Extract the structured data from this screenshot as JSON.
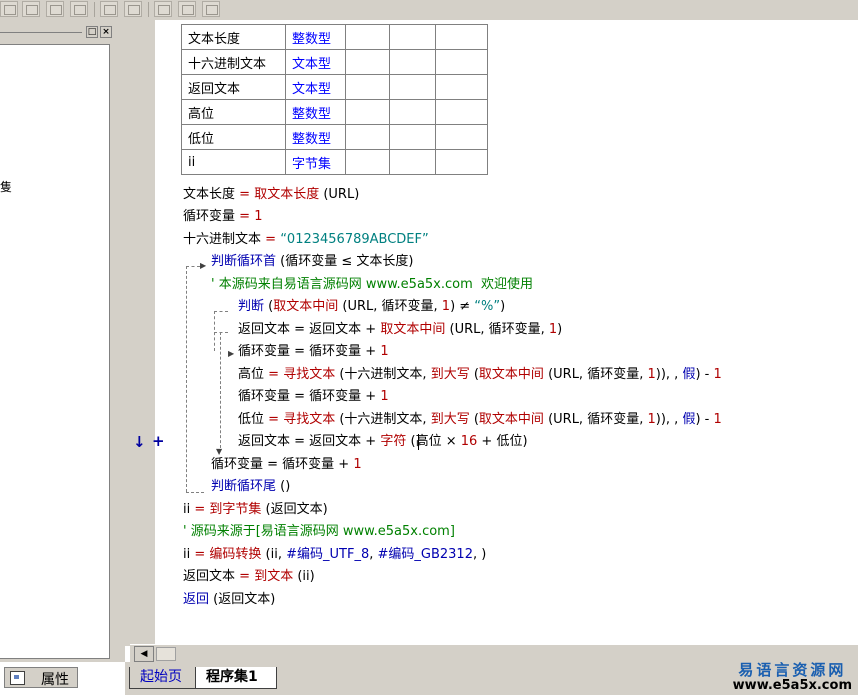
{
  "properties_tab": {
    "label": "属性"
  },
  "left_panel": {
    "minimize_label": "□",
    "close_label": "×",
    "visible_char": "隻"
  },
  "var_table": {
    "rows": [
      {
        "name": "文本长度",
        "type": "整数型"
      },
      {
        "name": "十六进制文本",
        "type": "文本型"
      },
      {
        "name": "返回文本",
        "type": "文本型"
      },
      {
        "name": "高位",
        "type": "整数型"
      },
      {
        "name": "低位",
        "type": "整数型"
      },
      {
        "name": "ii",
        "type": "字节集"
      }
    ]
  },
  "code": {
    "l1": {
      "a": "文本长度",
      "b": " = ",
      "c": "取文本长度",
      "d": " (URL)"
    },
    "l2": {
      "a": "循环变量",
      "b": " = ",
      "c": "1"
    },
    "l3": {
      "a": "十六进制文本",
      "b": " = ",
      "c": "“0123456789ABCDEF”"
    },
    "l4": {
      "a": "判断循环首",
      "b": " (循环变量 ≤ 文本长度)"
    },
    "l5": {
      "a": "' 本源码来自易语言源码网 www.e5a5x.com  欢迎使用"
    },
    "l6": {
      "a": "判断",
      "b": " (",
      "c": "取文本中间",
      "d": " (URL, 循环变量, ",
      "e": "1",
      "f": ") ≠ ",
      "g": "“%”",
      "h": ")"
    },
    "l7": {
      "a": "返回文本",
      "b": " = 返回文本 + ",
      "c": "取文本中间",
      "d": " (URL, 循环变量, ",
      "e": "1",
      "f": ")"
    },
    "l8": {
      "a": "循环变量",
      "b": " = 循环变量 + ",
      "c": "1"
    },
    "l9": {
      "a": "高位",
      "b": " = ",
      "c": "寻找文本",
      "d": " (十六进制文本, ",
      "e": "到大写",
      "f": " (",
      "g": "取文本中间",
      "h": " (URL, 循环变量, ",
      "i": "1",
      "j": ")), , ",
      "k": "假",
      "l": ") - ",
      "m": "1"
    },
    "l10": {
      "a": "循环变量",
      "b": " = 循环变量 + ",
      "c": "1"
    },
    "l11": {
      "a": "低位",
      "b": " = ",
      "c": "寻找文本",
      "d": " (十六进制文本, ",
      "e": "到大写",
      "f": " (",
      "g": "取文本中间",
      "h": " (URL, 循环变量, ",
      "i": "1",
      "j": ")), , ",
      "k": "假",
      "l": ") - ",
      "m": "1"
    },
    "l12": {
      "a": "返回文本",
      "b": " = 返回文本 + ",
      "c": "字符",
      "d": " (高位 × ",
      "e": "16",
      "f": " + 低位)"
    },
    "l13": {
      "a": "循环变量",
      "b": " = 循环变量 + ",
      "c": "1"
    },
    "l14": {
      "a": "判断循环尾",
      "b": " ()"
    },
    "l15": {
      "a": "ii",
      "b": " = ",
      "c": "到字节集",
      "d": " (返回文本)"
    },
    "l16": {
      "a": "' 源码来源于[易语言源码网 www.e5a5x.com]"
    },
    "l17": {
      "a": "ii",
      "b": " = ",
      "c": "编码转换",
      "d": " (ii, ",
      "e": "#编码_UTF_8",
      "f": ", ",
      "g": "#编码_GB2312",
      "h": ", )"
    },
    "l18": {
      "a": "返回文本",
      "b": " = ",
      "c": "到文本",
      "d": " (ii)"
    },
    "l19": {
      "a": "返回",
      "b": " (返回文本)"
    }
  },
  "gutter": {
    "arrow": "↓",
    "plus": "+"
  },
  "tabs": [
    {
      "label": "起始页"
    },
    {
      "label": "程序集1"
    }
  ],
  "scroll": {
    "left_arrow": "◀"
  },
  "watermark": {
    "line1": "易语言资源网",
    "line2": "www.e5a5x.com"
  }
}
